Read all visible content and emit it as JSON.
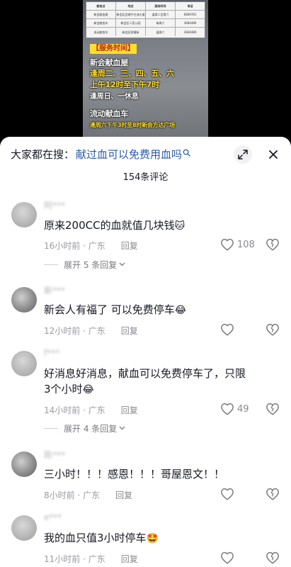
{
  "video": {
    "table_rows": [
      [
        "献血点",
        "地点",
        "服务时间",
        "电话"
      ],
      [
        "新会献血屋",
        "新会区会城今古洲大道",
        "逢周二至周六",
        "6689781"
      ],
      [
        "新会献血车",
        "新会区人民公园",
        "每周六",
        "3684489"
      ],
      [
        "流动献血车",
        "新会区各镇街",
        "逢周六",
        "3684489"
      ]
    ],
    "title_badge": "【服务时间】",
    "lines": [
      "新会献血屋",
      "逢周二、三、四、五、六",
      "上午12时至下午7时",
      "逢周日、一休息",
      "流动献血车",
      "逢周六下午3时至8时新会方达广场"
    ]
  },
  "sheet": {
    "search_prefix": "大家都在搜：",
    "search_query": "献过血可以免费用血吗",
    "comment_count": "154条评论"
  },
  "comments": [
    {
      "username": "阿***",
      "text": "原来200CC的血就值几块钱",
      "time_location": "16小时前 · 广东",
      "reply_label": "回复",
      "likes": "108",
      "expand_label": "展开 5 条回复"
    },
    {
      "username": "新***",
      "text": "新会人有福了 可以免费停车",
      "time_location": "12小时前 · 广东",
      "reply_label": "回复",
      "likes": ""
    },
    {
      "username": "f***",
      "text": "好消息好消息，献血可以免费停车了，只限3个小时",
      "time_location": "14小时前 · 广东",
      "reply_label": "回复",
      "likes": "49",
      "expand_label": "展开 4 条回复"
    },
    {
      "username": "陈***",
      "text": "三小时！！！感恩！！！哥屋恩文！！",
      "time_location": "8小时前 · 广东",
      "reply_label": "回复",
      "likes": ""
    },
    {
      "username": "e***",
      "text": "我的血只值3小时停车",
      "time_location": "11小时前 · 广东",
      "reply_label": "回复",
      "likes": ""
    }
  ],
  "icons": {
    "like": "heart-outline-icon",
    "dislike": "broken-heart-icon",
    "expand": "expand-arrows-icon",
    "close": "close-icon"
  },
  "colors": {
    "search_query": "#2b5aa8",
    "text": "#161823",
    "meta": "#9a9aa1",
    "overlay_yellow": "#ffde2e"
  }
}
